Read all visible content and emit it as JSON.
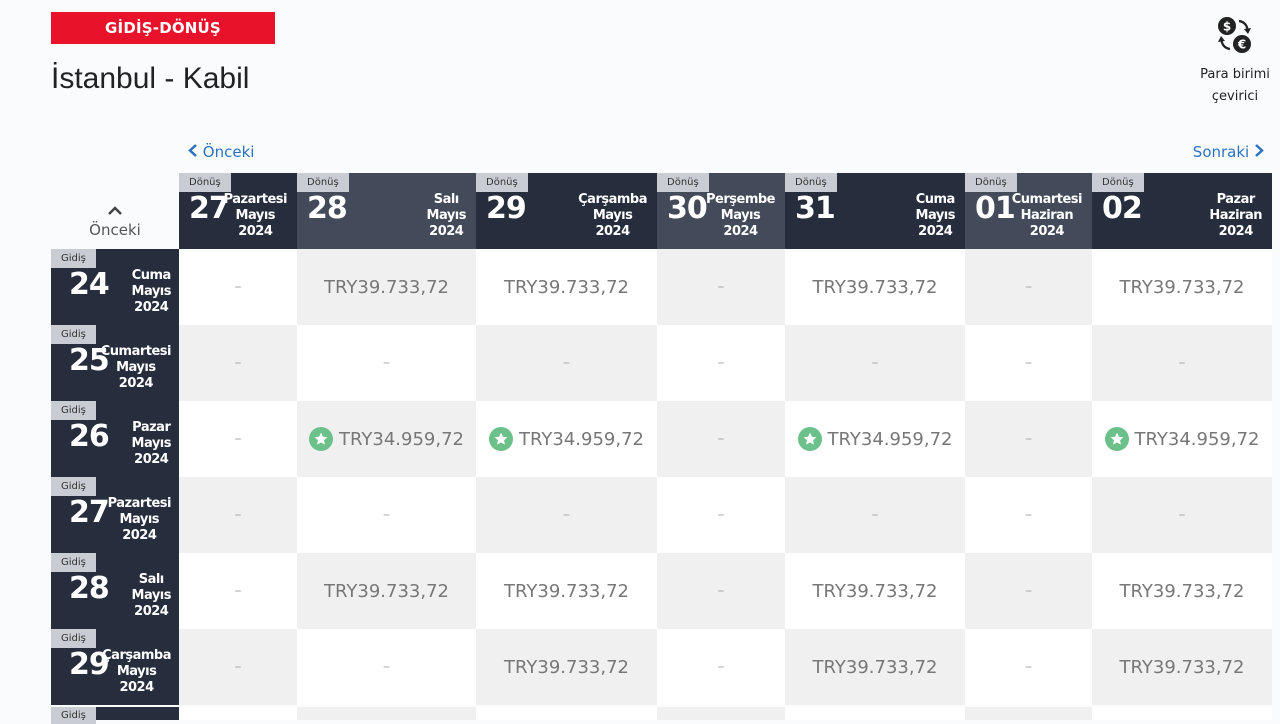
{
  "trip_type": "GİDİŞ-DÖNÜŞ",
  "route": "İstanbul - Kabil",
  "currency_converter": {
    "line1": "Para birimi",
    "line2": "çevirici"
  },
  "nav": {
    "prev": "Önceki",
    "next": "Sonraki",
    "prev_rows": "Önceki"
  },
  "return_badge": "Dönüş",
  "depart_badge": "Gidiş",
  "columns": [
    {
      "day": "27",
      "weekday": "Pazartesi",
      "month": "Mayıs",
      "year": "2024"
    },
    {
      "day": "28",
      "weekday": "Salı",
      "month": "Mayıs",
      "year": "2024"
    },
    {
      "day": "29",
      "weekday": "Çarşamba",
      "month": "Mayıs",
      "year": "2024"
    },
    {
      "day": "30",
      "weekday": "Perşembe",
      "month": "Mayıs",
      "year": "2024"
    },
    {
      "day": "31",
      "weekday": "Cuma",
      "month": "Mayıs",
      "year": "2024"
    },
    {
      "day": "01",
      "weekday": "Cumartesi",
      "month": "Haziran",
      "year": "2024"
    },
    {
      "day": "02",
      "weekday": "Pazar",
      "month": "Haziran",
      "year": "2024"
    }
  ],
  "rows": [
    {
      "day": "24",
      "weekday": "Cuma",
      "month": "Mayıs",
      "year": "2024",
      "cells": [
        "–",
        "TRY39.733,72",
        "TRY39.733,72",
        "–",
        "TRY39.733,72",
        "–",
        "TRY39.733,72"
      ]
    },
    {
      "day": "25",
      "weekday": "Cumartesi",
      "month": "Mayıs",
      "year": "2024",
      "cells": [
        "–",
        "–",
        "–",
        "–",
        "–",
        "–",
        "–"
      ]
    },
    {
      "day": "26",
      "weekday": "Pazar",
      "month": "Mayıs",
      "year": "2024",
      "cells": [
        "–",
        "★TRY34.959,72",
        "★TRY34.959,72",
        "–",
        "★TRY34.959,72",
        "–",
        "★TRY34.959,72"
      ]
    },
    {
      "day": "27",
      "weekday": "Pazartesi",
      "month": "Mayıs",
      "year": "2024",
      "cells": [
        "–",
        "–",
        "–",
        "–",
        "–",
        "–",
        "–"
      ]
    },
    {
      "day": "28",
      "weekday": "Salı",
      "month": "Mayıs",
      "year": "2024",
      "cells": [
        "–",
        "TRY39.733,72",
        "TRY39.733,72",
        "–",
        "TRY39.733,72",
        "–",
        "TRY39.733,72"
      ]
    },
    {
      "day": "29",
      "weekday": "Çarşamba",
      "month": "Mayıs",
      "year": "2024",
      "cells": [
        "–",
        "–",
        "TRY39.733,72",
        "–",
        "TRY39.733,72",
        "–",
        "TRY39.733,72"
      ]
    }
  ],
  "colors": {
    "accent": "#e8122b",
    "header_dark": "#262d3d",
    "header_mid": "#434a59",
    "best_price": "#6cc18a",
    "link": "#2a73c4"
  }
}
